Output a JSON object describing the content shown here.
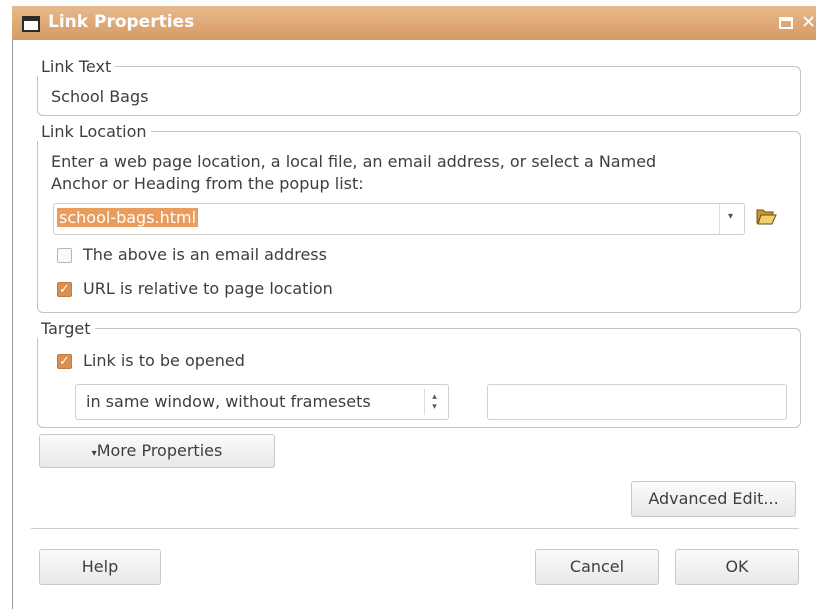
{
  "window": {
    "title": "Link Properties"
  },
  "link_text": {
    "legend": "Link Text",
    "value": "School Bags"
  },
  "link_location": {
    "legend": "Link Location",
    "instruction_line1": "Enter a web page location, a local file, an email address, or select a Named",
    "instruction_line2": "Anchor or Heading from the popup list:",
    "url_value": "school-bags.html",
    "email_checkbox": {
      "label": "The above is an email address",
      "checked": false
    },
    "relative_checkbox": {
      "label": "URL is relative to page location",
      "checked": true
    }
  },
  "target": {
    "legend": "Target",
    "open_checkbox": {
      "label": "Link is to be opened",
      "checked": true
    },
    "window_select": "in same window, without framesets",
    "target_name_value": ""
  },
  "buttons": {
    "more_properties": "More Properties",
    "advanced_edit": "Advanced Edit...",
    "help": "Help",
    "cancel": "Cancel",
    "ok": "OK"
  },
  "icons": {
    "browse": "folder-open-icon",
    "dropdown_arrow": "chevron-down-icon",
    "spin": "up-down-arrows-icon"
  },
  "colors": {
    "accent": "#e99c5c",
    "titlebar": "#dba06a"
  }
}
